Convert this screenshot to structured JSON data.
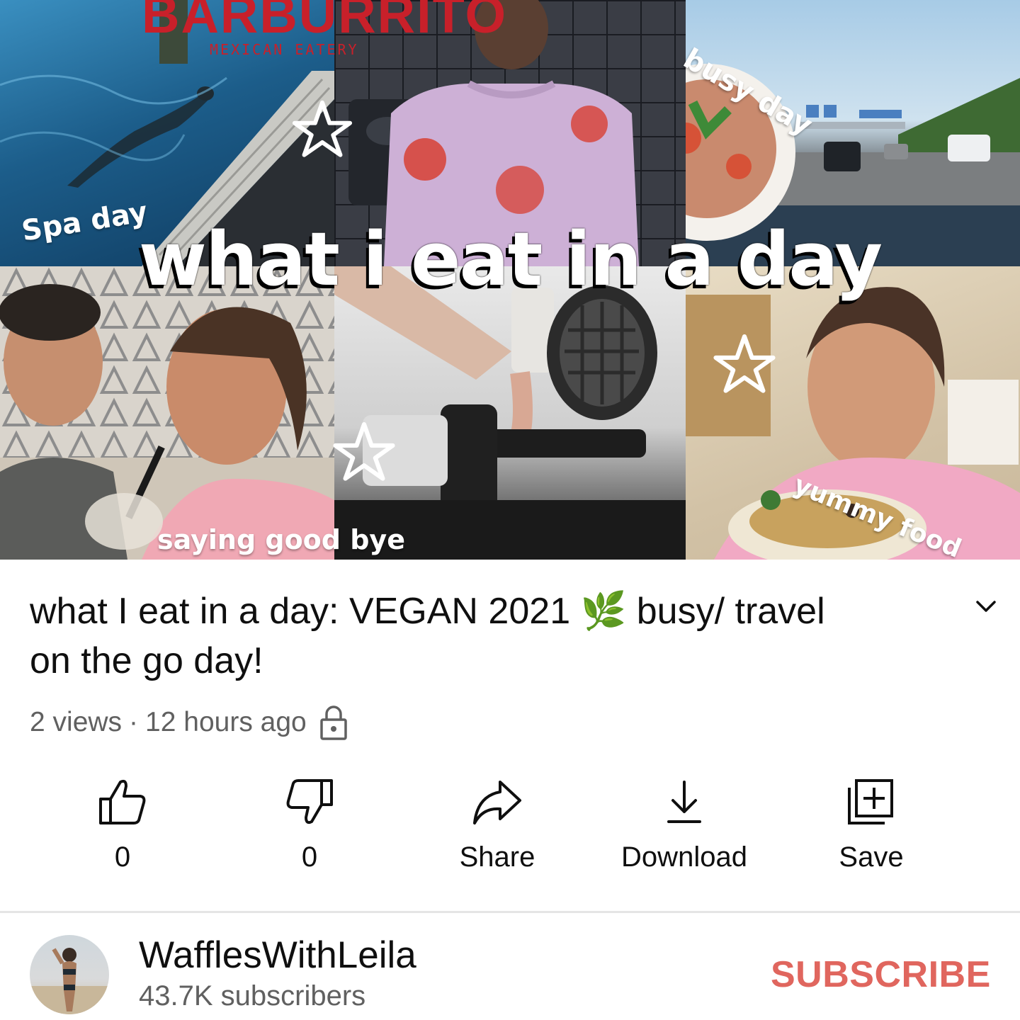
{
  "thumbnail": {
    "main_title": "what i eat in a day",
    "brand": "BARBURRITO",
    "brand_sub": "MEXICAN EATERY",
    "captions": {
      "spa": "Spa day",
      "busy": "busy day",
      "goodbye": "saying good bye",
      "yummy": "yummy food"
    }
  },
  "video": {
    "title_line1": "what I eat in a day: VEGAN 2021 🌿 busy/ travel",
    "title_line2": "on the go day!",
    "views": "2 views",
    "separator": "·",
    "age": "12 hours ago",
    "privacy_icon": "lock-icon"
  },
  "actions": {
    "like": {
      "icon": "thumbs-up-icon",
      "label": "0"
    },
    "dislike": {
      "icon": "thumbs-down-icon",
      "label": "0"
    },
    "share": {
      "icon": "share-arrow-icon",
      "label": "Share"
    },
    "download": {
      "icon": "download-icon",
      "label": "Download"
    },
    "save": {
      "icon": "add-to-playlist-icon",
      "label": "Save"
    }
  },
  "channel": {
    "name": "WafflesWithLeila",
    "subscribers": "43.7K subscribers",
    "subscribe_label": "SUBSCRIBE"
  },
  "colors": {
    "subscribe": "#e0665e",
    "meta_text": "#606060",
    "brand_red": "#c8202a"
  }
}
